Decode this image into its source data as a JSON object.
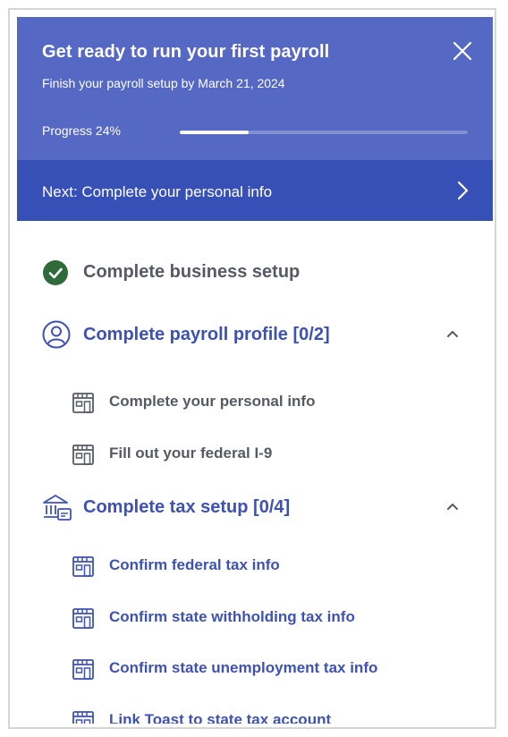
{
  "header": {
    "title": "Get ready to run your first payroll",
    "subtitle": "Finish your payroll setup by March 21, 2024",
    "progress_label": "Progress 24%",
    "progress_fraction": 0.24,
    "close_icon": "close-icon"
  },
  "next_step": {
    "label": "Next: Complete your personal info",
    "icon": "chevron-right-icon"
  },
  "sections": [
    {
      "label": "Complete business setup",
      "icon": "check-circle-icon",
      "status": "complete"
    },
    {
      "label": "Complete payroll profile [0/2]",
      "icon": "user-circle-icon",
      "expanded": true,
      "items": [
        {
          "label": "Complete your personal info",
          "icon": "building-icon"
        },
        {
          "label": "Fill out your federal I-9",
          "icon": "building-icon"
        }
      ]
    },
    {
      "label": "Complete tax setup [0/4]",
      "icon": "bank-icon",
      "expanded": true,
      "items": [
        {
          "label": "Confirm federal tax info",
          "icon": "building-icon"
        },
        {
          "label": "Confirm state withholding tax info",
          "icon": "building-icon"
        },
        {
          "label": "Confirm state unemployment tax info",
          "icon": "building-icon"
        },
        {
          "label": "Link Toast to state tax account",
          "icon": "building-icon"
        }
      ]
    }
  ],
  "colors": {
    "header_bg": "#5468c4",
    "next_bg": "#3650b8",
    "link": "#3d52b3",
    "success": "#2f6b3a",
    "muted_text": "#555a63"
  }
}
